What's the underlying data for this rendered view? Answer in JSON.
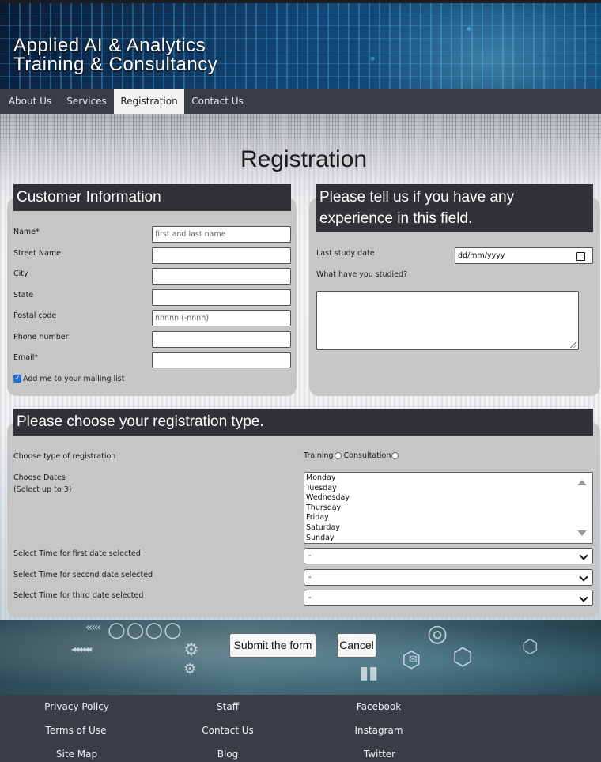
{
  "header": {
    "brand_line1": "Applied AI & Analytics",
    "brand_line2": "Training & Consultancy"
  },
  "nav": {
    "tabs": [
      {
        "label": "About Us"
      },
      {
        "label": "Services"
      },
      {
        "label": "Registration",
        "active": true
      },
      {
        "label": "Contact Us"
      }
    ]
  },
  "page": {
    "title": "Registration"
  },
  "customer": {
    "heading": "Customer Information",
    "fields": [
      {
        "label": "Name*",
        "placeholder": "first and last name"
      },
      {
        "label": "Street Name",
        "placeholder": ""
      },
      {
        "label": "City",
        "placeholder": ""
      },
      {
        "label": "State",
        "placeholder": ""
      },
      {
        "label": "Postal code",
        "placeholder": "nnnnn (-nnnn)"
      },
      {
        "label": "Phone number",
        "placeholder": ""
      },
      {
        "label": "Email*",
        "placeholder": ""
      }
    ],
    "mailing_label": "Add me to your mailing list",
    "mailing_checked": true
  },
  "experience": {
    "heading": "Please tell us if you have any experience in this field.",
    "last_study_label": "Last study date",
    "last_study_placeholder": "dd/mm/yyyy",
    "studied_label": "What have you studied?"
  },
  "registration": {
    "heading": "Please choose your registration type.",
    "type_label": "Choose type of registration",
    "type_options": [
      "Training",
      "Consultation"
    ],
    "dates_label": "Choose Dates",
    "dates_note": "(Select up to 3)",
    "days": [
      "Monday",
      "Tuesday",
      "Wednesday",
      "Thursday",
      "Friday",
      "Saturday",
      "Sunday"
    ],
    "time_labels": [
      "Select Time for first date selected",
      "Select Time for second date selected",
      "Select Time for third date selected"
    ],
    "time_values": [
      "-",
      "-",
      "-"
    ]
  },
  "actions": {
    "submit": "Submit the form",
    "cancel": "Cancel"
  },
  "footer": {
    "col1": [
      "Privacy Policy",
      "Terms of Use",
      "Site Map"
    ],
    "col2": [
      "Staff",
      "Contact Us",
      "Blog"
    ],
    "col3": [
      "Facebook",
      "Instagram",
      "Twitter"
    ]
  },
  "colors": {
    "nav_bg": "#393d46",
    "panel_bg": "#c6c6c6",
    "panel_head_bg": "#303235",
    "checkbox_accent": "#1e6fd8"
  }
}
